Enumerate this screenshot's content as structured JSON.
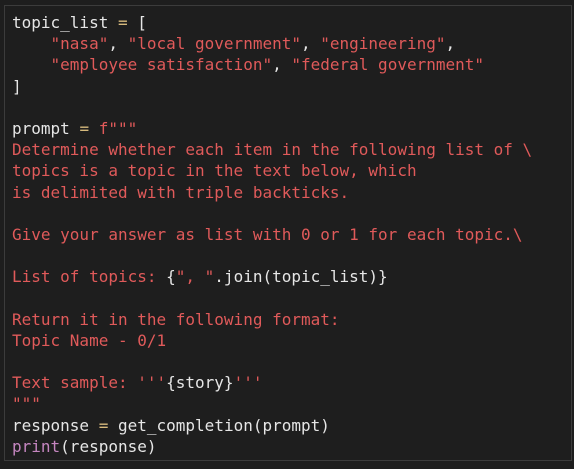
{
  "code_lines": [
    [
      {
        "t": "var",
        "v": "topic_list"
      },
      {
        "t": "pun",
        "v": " "
      },
      {
        "t": "op",
        "v": "="
      },
      {
        "t": "pun",
        "v": " ["
      }
    ],
    [
      {
        "t": "pun",
        "v": "    "
      },
      {
        "t": "str",
        "v": "\"nasa\""
      },
      {
        "t": "pun",
        "v": ", "
      },
      {
        "t": "str",
        "v": "\"local government\""
      },
      {
        "t": "pun",
        "v": ", "
      },
      {
        "t": "str",
        "v": "\"engineering\""
      },
      {
        "t": "pun",
        "v": ","
      }
    ],
    [
      {
        "t": "pun",
        "v": "    "
      },
      {
        "t": "str",
        "v": "\"employee satisfaction\""
      },
      {
        "t": "pun",
        "v": ", "
      },
      {
        "t": "str",
        "v": "\"federal government\""
      }
    ],
    [
      {
        "t": "pun",
        "v": "]"
      }
    ],
    [],
    [
      {
        "t": "var",
        "v": "prompt"
      },
      {
        "t": "pun",
        "v": " "
      },
      {
        "t": "op",
        "v": "="
      },
      {
        "t": "pun",
        "v": " "
      },
      {
        "t": "str",
        "v": "f\"\"\""
      }
    ],
    [
      {
        "t": "str",
        "v": "Determine whether each item in the following list of \\"
      }
    ],
    [
      {
        "t": "str",
        "v": "topics is a topic in the text below, which"
      }
    ],
    [
      {
        "t": "str",
        "v": "is delimited with triple backticks."
      }
    ],
    [],
    [
      {
        "t": "str",
        "v": "Give your answer as list with 0 or 1 for each topic.\\"
      }
    ],
    [],
    [
      {
        "t": "str",
        "v": "List of topics: "
      },
      {
        "t": "pun",
        "v": "{"
      },
      {
        "t": "str",
        "v": "\", \""
      },
      {
        "t": "pun",
        "v": ".join(topic_list)}"
      }
    ],
    [],
    [
      {
        "t": "str",
        "v": "Return it in the following format:"
      }
    ],
    [
      {
        "t": "str",
        "v": "Topic Name - 0/1"
      }
    ],
    [],
    [
      {
        "t": "str",
        "v": "Text sample: '''"
      },
      {
        "t": "pun",
        "v": "{story}"
      },
      {
        "t": "str",
        "v": "'''"
      }
    ],
    [
      {
        "t": "str",
        "v": "\"\"\""
      }
    ],
    [
      {
        "t": "var",
        "v": "response"
      },
      {
        "t": "pun",
        "v": " "
      },
      {
        "t": "op",
        "v": "="
      },
      {
        "t": "pun",
        "v": " "
      },
      {
        "t": "fn",
        "v": "get_completion"
      },
      {
        "t": "pun",
        "v": "(prompt)"
      }
    ],
    [
      {
        "t": "kw",
        "v": "print"
      },
      {
        "t": "pun",
        "v": "(response)"
      }
    ]
  ]
}
